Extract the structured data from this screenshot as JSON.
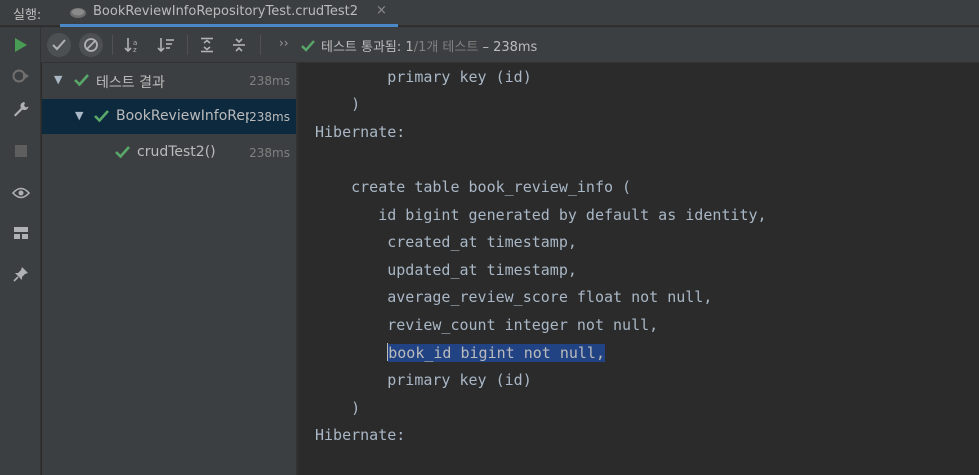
{
  "tabbar": {
    "run_label": "실행:",
    "tab_title": "BookReviewInfoRepositoryTest.crudTest2",
    "close_glyph": "×"
  },
  "toolbar": {
    "chevron": "››",
    "status_pass": "테스트 통과됨: 1",
    "status_count": "/1개 테스트",
    "status_time": "– 238ms",
    "icons": [
      "show-passed-icon",
      "show-ignored-icon",
      "sort-alpha-icon",
      "sort-duration-icon",
      "expand-all-icon",
      "collapse-all-icon"
    ]
  },
  "leftstrip": {
    "icons": [
      "rerun-icon",
      "rerun-failed-icon",
      "wrench-icon",
      "stop-icon",
      "eye-icon",
      "layout-icon",
      "pin-icon"
    ]
  },
  "tree": {
    "rows": [
      {
        "label": "테스트 결과",
        "time": "238ms",
        "expanded": true
      },
      {
        "label": "BookReviewInfoRepositoryTest",
        "time": "238ms",
        "expanded": true,
        "selected": true
      },
      {
        "label": "crudTest2()",
        "time": "238ms"
      }
    ]
  },
  "console": {
    "lines": [
      "        primary key (id)",
      "    )",
      "Hibernate:",
      "",
      "    create table book_review_info (",
      "       id bigint generated by default as identity,",
      "        created_at timestamp,",
      "        updated_at timestamp,",
      "        average_review_score float not null,",
      "        review_count integer not null,",
      "        book_id bigint not null,",
      "        primary key (id)",
      "    )",
      "Hibernate:"
    ],
    "selected_line_index": 10
  },
  "colors": {
    "accent": "#4a88c7",
    "pass_green": "#59a869",
    "selection": "#214283",
    "tree_selection": "#0d293e"
  }
}
